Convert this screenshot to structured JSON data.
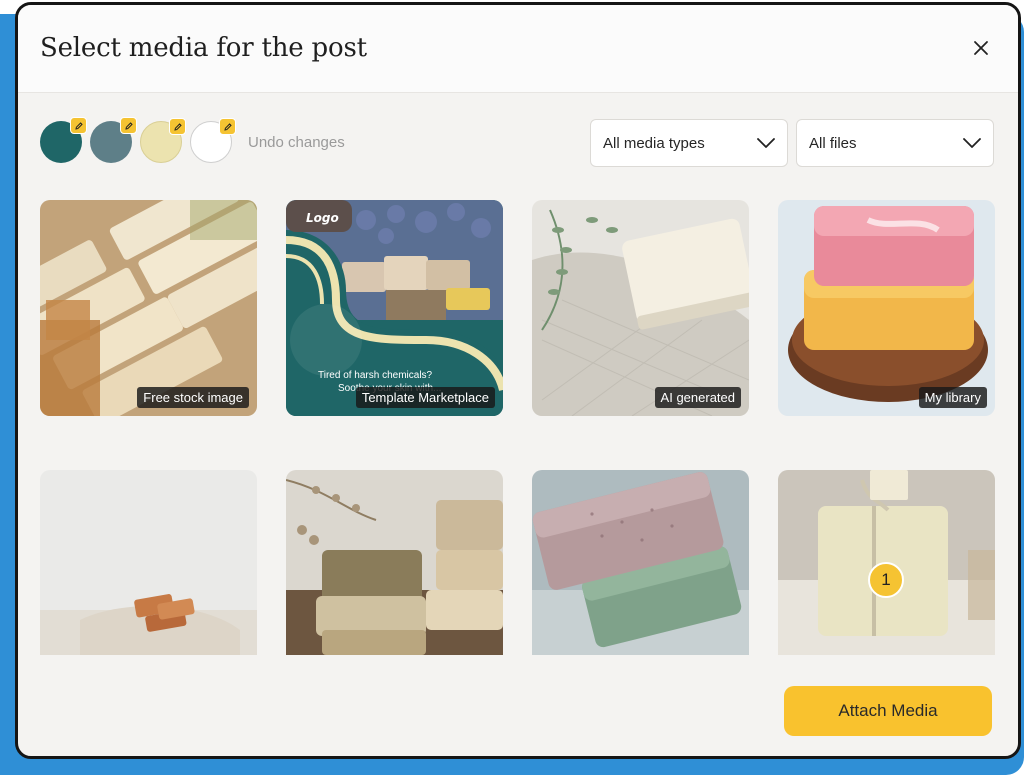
{
  "modal": {
    "title": "Select media for the post",
    "close_icon": "close-icon"
  },
  "toolbar": {
    "swatches": [
      {
        "color": "#1f6667"
      },
      {
        "color": "#5e7f88"
      },
      {
        "color": "#ece3af"
      },
      {
        "color": "#ffffff"
      }
    ],
    "undo_label": "Undo changes",
    "media_type_select": {
      "value": "All media types"
    },
    "files_select": {
      "value": "All files"
    }
  },
  "media": [
    {
      "label": "Free stock image"
    },
    {
      "label": "Template Marketplace",
      "template_logo": "Logo",
      "template_text_1": "Tired of harsh chemicals?",
      "template_text_2": "Soothe your skin with..."
    },
    {
      "label": "AI generated"
    },
    {
      "label": "My library"
    },
    {},
    {},
    {},
    {
      "selected_index": "1"
    }
  ],
  "footer": {
    "attach_label": "Attach Media"
  },
  "colors": {
    "accent": "#f9c22e",
    "backdrop": "#2f8fd6",
    "teal": "#1f6667"
  }
}
